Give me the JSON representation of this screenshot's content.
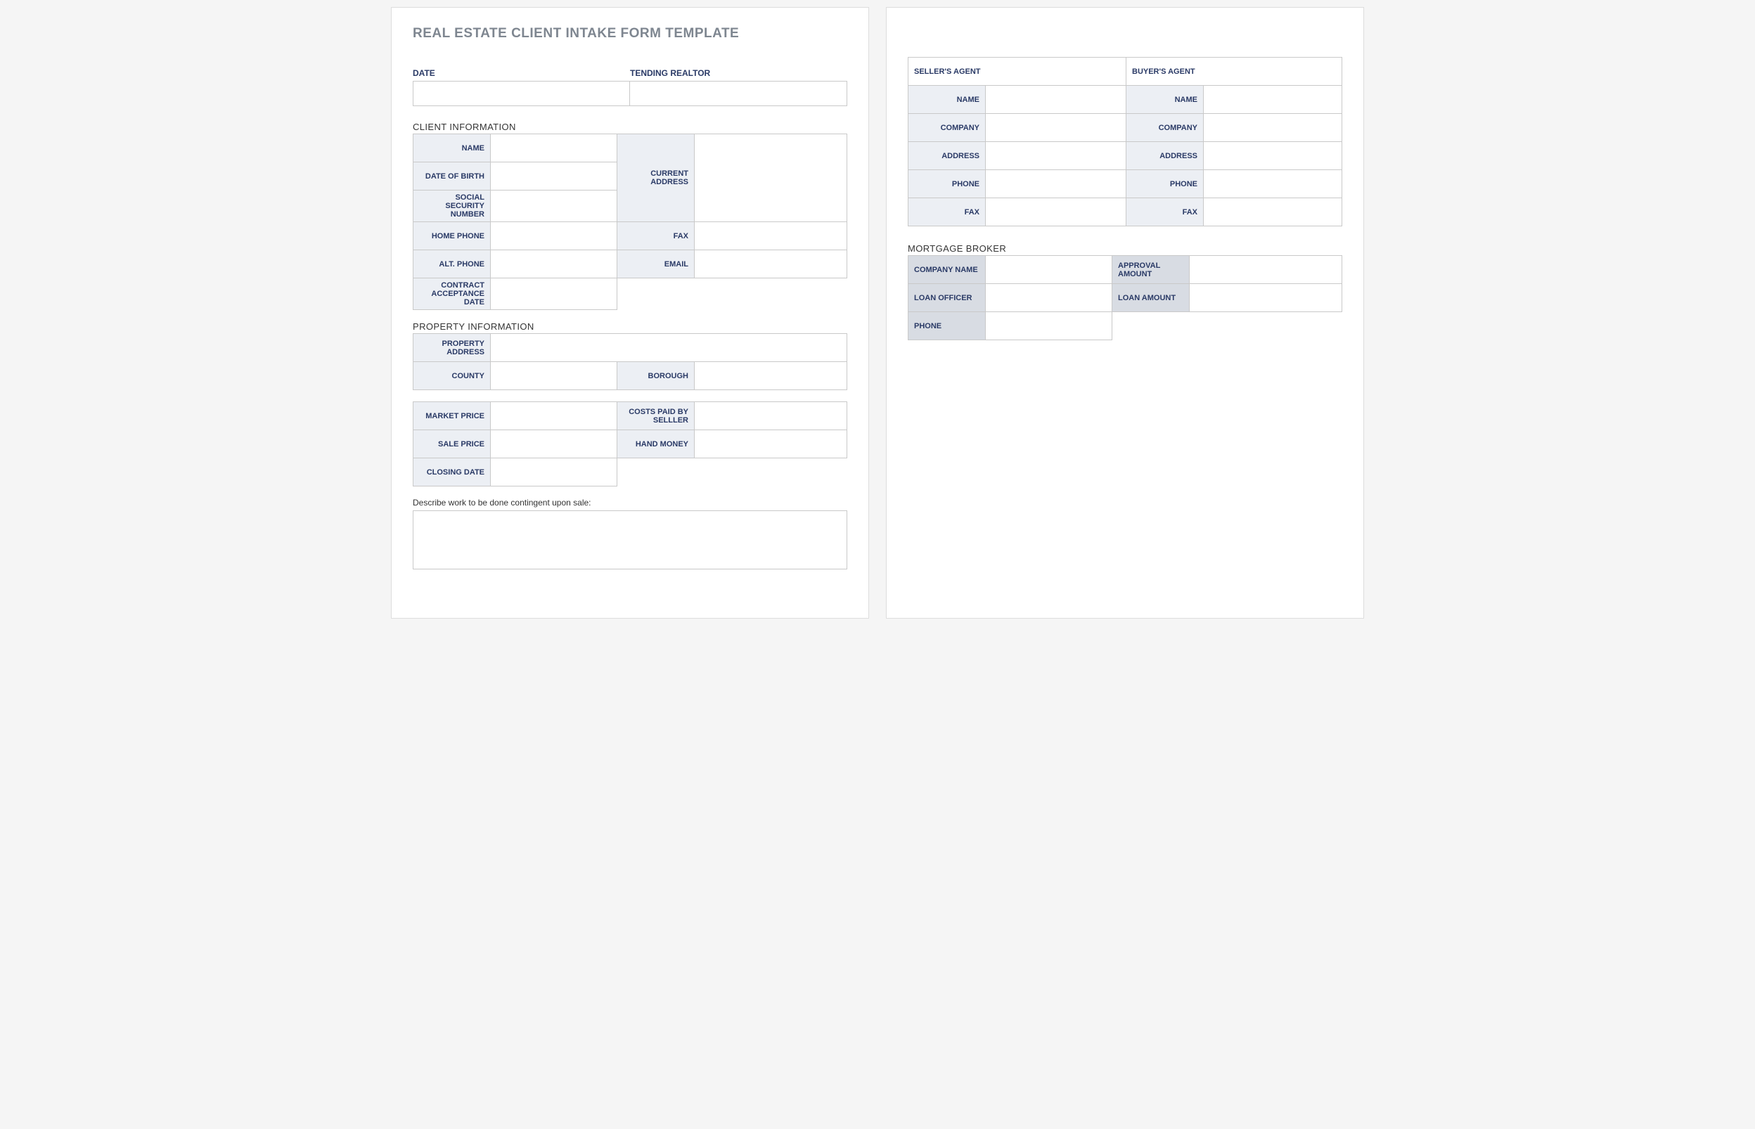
{
  "title": "REAL ESTATE CLIENT INTAKE FORM TEMPLATE",
  "top": {
    "date_label": "DATE",
    "tending_realtor_label": "TENDING REALTOR"
  },
  "client": {
    "heading": "CLIENT INFORMATION",
    "name": "NAME",
    "dob": "DATE OF BIRTH",
    "ssn": "SOCIAL SECURITY NUMBER",
    "home_phone": "HOME PHONE",
    "alt_phone": "ALT. PHONE",
    "contract_acceptance": "CONTRACT ACCEPTANCE DATE",
    "current_address": "CURRENT ADDRESS",
    "fax": "FAX",
    "email": "EMAIL"
  },
  "property": {
    "heading": "PROPERTY INFORMATION",
    "address": "PROPERTY ADDRESS",
    "county": "COUNTY",
    "borough": "BOROUGH",
    "market_price": "MARKET PRICE",
    "costs_paid": "COSTS PAID BY SELLLER",
    "sale_price": "SALE PRICE",
    "hand_money": "HAND MONEY",
    "closing_date": "CLOSING DATE",
    "describe_label": "Describe work to be done contingent upon sale:"
  },
  "agents": {
    "seller_heading": "SELLER'S AGENT",
    "buyer_heading": "BUYER'S AGENT",
    "name": "NAME",
    "company": "COMPANY",
    "address": "ADDRESS",
    "phone": "PHONE",
    "fax": "FAX"
  },
  "broker": {
    "heading": "MORTGAGE BROKER",
    "company_name": "COMPANY NAME",
    "loan_officer": "LOAN OFFICER",
    "phone": "PHONE",
    "approval_amount": "APPROVAL AMOUNT",
    "loan_amount": "LOAN AMOUNT"
  }
}
